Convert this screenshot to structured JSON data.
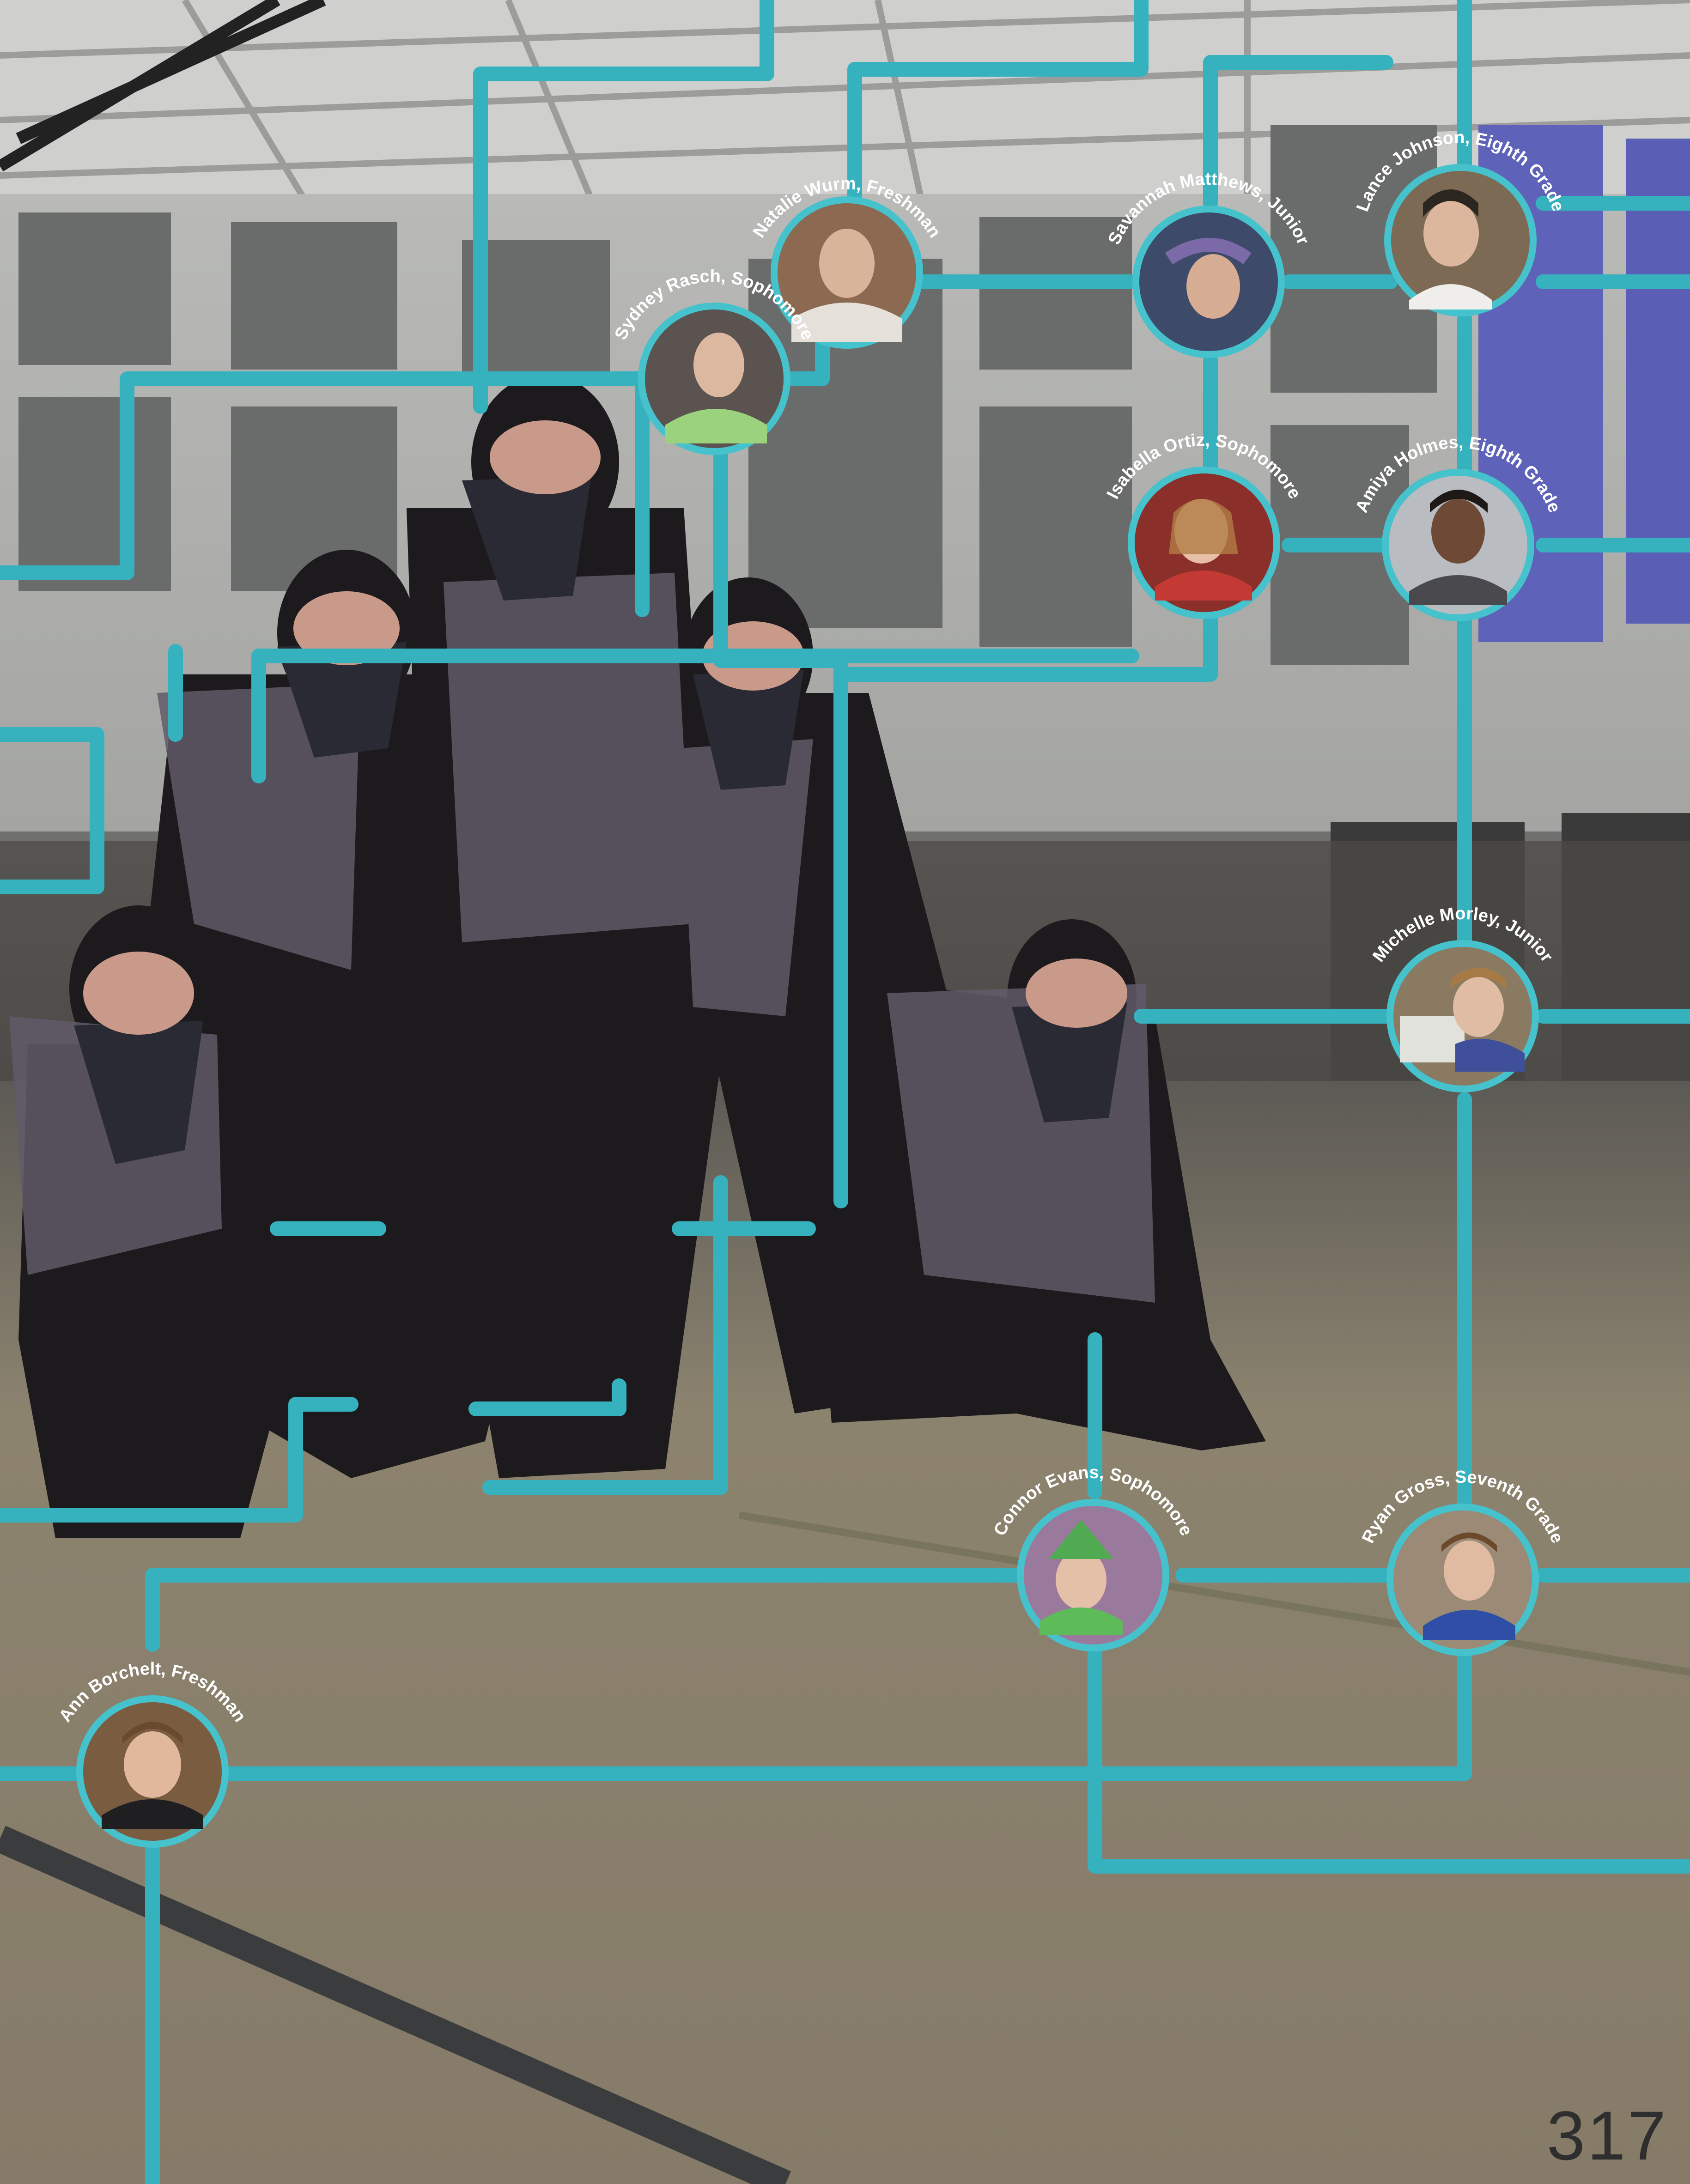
{
  "page_number": "317",
  "colors": {
    "connector": "#35b2be",
    "ring": "#45c2cc",
    "label": "#ffffff"
  },
  "portraits": [
    {
      "label": "Natalie Wurm, Freshman"
    },
    {
      "label": "Savannah Matthews, Junior"
    },
    {
      "label": "Lance Johnson, Eighth Grade"
    },
    {
      "label": "Sydney Rasch, Sophomore"
    },
    {
      "label": "Isabella Ortiz, Sophomore"
    },
    {
      "label": "Amiya Holmes, Eighth Grade"
    },
    {
      "label": "Michelle Morley, Junior"
    },
    {
      "label": "Connor Evans, Sophomore"
    },
    {
      "label": "Ryan Gross, Seventh Grade"
    },
    {
      "label": "Ann Borchelt, Freshman"
    }
  ]
}
